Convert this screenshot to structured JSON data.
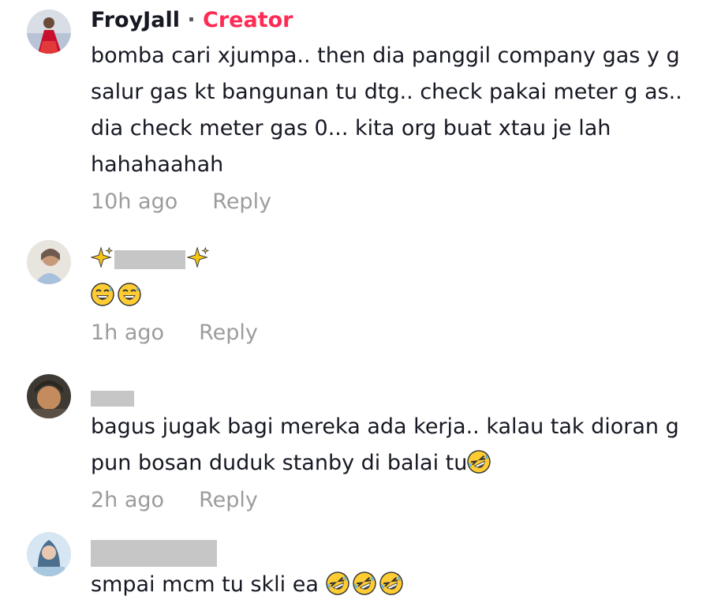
{
  "comments": [
    {
      "username": "FroyJall",
      "separator": "·",
      "badge": "Creator",
      "text": "bomba cari xjumpa.. then dia panggil company gas y g salur gas kt bangunan tu dtg.. check pakai meter g as.. dia check meter gas 0... kita org buat xtau je lah hahahaahah",
      "time": "10h ago",
      "reply": "Reply"
    },
    {
      "username_emoji_left": "sparkles-icon",
      "username_emoji_right": "sparkles-icon",
      "text_emojis": [
        "grinning-sweat-face-icon",
        "grinning-sweat-face-icon"
      ],
      "time": "1h ago",
      "reply": "Reply"
    },
    {
      "text": "bagus jugak bagi mereka ada kerja.. kalau tak dioran g pun bosan duduk stanby di balai tu",
      "text_emojis": [
        "rolling-laughing-face-icon"
      ],
      "time": "2h ago",
      "reply": "Reply"
    },
    {
      "text": "smpai mcm tu skli ea",
      "text_emojis": [
        "rolling-laughing-face-icon",
        "rolling-laughing-face-icon",
        "rolling-laughing-face-icon"
      ]
    }
  ],
  "colors": {
    "creator": "#fe2c55",
    "meta": "#9c9c9c",
    "text": "#161823",
    "redaction": "#c6c6c6"
  }
}
